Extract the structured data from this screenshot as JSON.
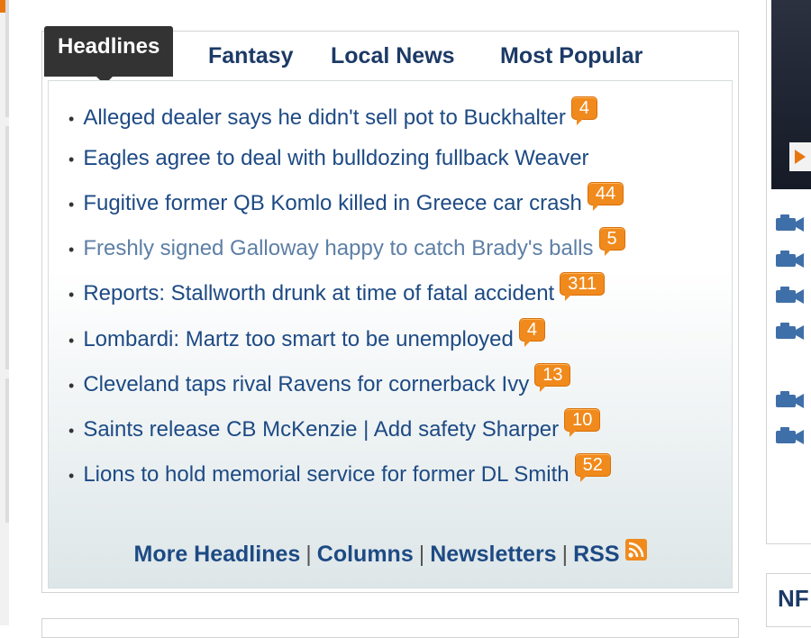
{
  "tabs": [
    {
      "label": "Headlines",
      "active": true
    },
    {
      "label": "Fantasy",
      "active": false
    },
    {
      "label": "Local News",
      "active": false
    },
    {
      "label": "Most Popular",
      "active": false
    }
  ],
  "headlines": [
    {
      "text": "Alleged dealer says he didn't sell pot to Buckhalter",
      "comments": "4"
    },
    {
      "text": "Eagles agree to deal with bulldozing fullback Weaver",
      "comments": ""
    },
    {
      "text": "Fugitive former QB Komlo killed in Greece car crash",
      "comments": "44"
    },
    {
      "text": "Freshly signed Galloway happy to catch Brady's balls",
      "comments": "5",
      "visited": true
    },
    {
      "text": "Reports: Stallworth drunk at time of fatal accident",
      "comments": "311"
    },
    {
      "text": "Lombardi: Martz too smart to be unemployed",
      "comments": "4"
    },
    {
      "text": "Cleveland taps rival Ravens for cornerback Ivy",
      "comments": "13"
    },
    {
      "text": "Saints release CB McKenzie | Add safety Sharper",
      "comments": "10"
    },
    {
      "text": "Lions to hold memorial service for former DL Smith",
      "comments": "52"
    }
  ],
  "footer": {
    "more_headlines": "More Headlines",
    "columns": "Columns",
    "newsletters": "Newsletters",
    "rss": "RSS",
    "separator": "|"
  },
  "right_column": {
    "section_label": "NF",
    "video_icons": [
      "video-camera-icon",
      "video-camera-icon",
      "video-camera-icon",
      "video-camera-icon",
      "video-camera-icon",
      "video-camera-icon"
    ]
  },
  "colors": {
    "link": "#1d4a84",
    "visited_link": "#5d7fa6",
    "badge": "#f08a1c",
    "active_tab": "#333333"
  }
}
